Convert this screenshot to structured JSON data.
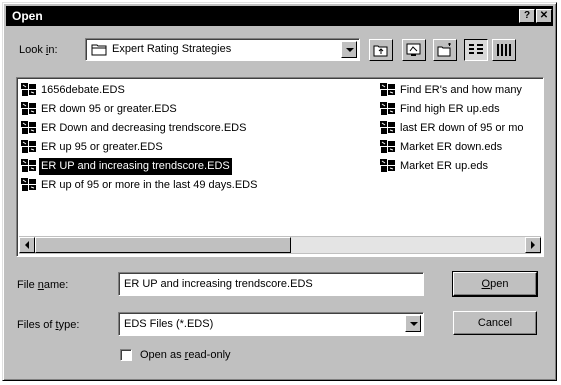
{
  "dialog": {
    "title": "Open"
  },
  "title_buttons": {
    "help": "?",
    "close": "✕"
  },
  "look_in": {
    "label_pre": "Look ",
    "label_key": "i",
    "label_post": "n:",
    "value": "Expert Rating Strategies"
  },
  "toolbar": {
    "icons": [
      "up-folder-icon",
      "desktop-icon",
      "new-folder-icon",
      "list-view-icon",
      "details-view-icon"
    ]
  },
  "files": {
    "column1": [
      "1656debate.EDS",
      "ER down 95 or greater.EDS",
      "ER Down and decreasing trendscore.EDS",
      "ER up 95 or greater.EDS",
      "ER UP and increasing trendscore.EDS",
      "ER up of 95 or more in the last 49 days.EDS"
    ],
    "column2": [
      "Find ER's and how many",
      "Find high ER up.eds",
      "last ER down of 95 or mo",
      "Market ER down.eds",
      "Market ER up.eds"
    ],
    "selected_index": 4
  },
  "file_name": {
    "label_pre": "File ",
    "label_key": "n",
    "label_post": "ame:",
    "value": "ER UP and increasing trendscore.EDS"
  },
  "file_type": {
    "label_pre": "Files of ",
    "label_key": "t",
    "label_post": "ype:",
    "value": "EDS Files (*.EDS)"
  },
  "readonly": {
    "label_pre": "Open as ",
    "label_key": "r",
    "label_post": "ead-only",
    "checked": false
  },
  "buttons": {
    "open": {
      "key": "O",
      "rest": "pen"
    },
    "cancel": "Cancel"
  }
}
